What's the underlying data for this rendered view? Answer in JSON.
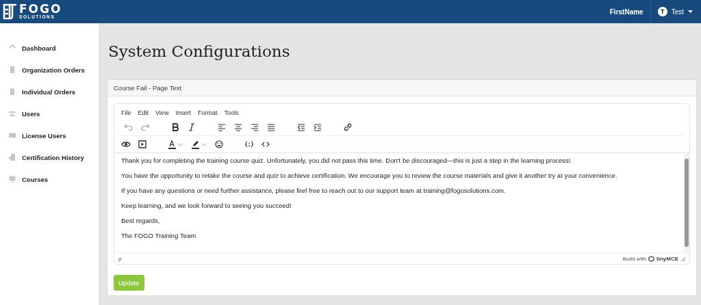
{
  "header": {
    "logo_main": "FOGO",
    "logo_sub": "SOLUTIONS",
    "user_name": "FirstName",
    "avatar_initial": "T",
    "account_label": "Test"
  },
  "sidebar": {
    "items": [
      {
        "label": "Dashboard",
        "selected": false
      },
      {
        "label": "Organization Orders",
        "selected": false
      },
      {
        "label": "Individual Orders",
        "selected": false
      },
      {
        "label": "Users",
        "selected": false
      },
      {
        "label": "License Users",
        "selected": false
      },
      {
        "label": "Certification History",
        "selected": false
      },
      {
        "label": "Courses",
        "selected": false
      }
    ]
  },
  "page_title": "System Configurations",
  "card": {
    "title": "Course Fail - Page Text",
    "editor": {
      "menu": [
        "File",
        "Edit",
        "View",
        "Insert",
        "Format",
        "Tools"
      ],
      "paragraphs": [
        "Thank you for completing the training course quiz. Unfortunately, you did not pass this time. Don't be discouraged—this is just a step in the learning process!",
        "You have the opportunity to retake the course and quiz to achieve certification. We encourage you to review the course materials and give it another try at your convenience.",
        "If you have any questions or need further assistance, please feel free to reach out to our support team at training@fogosolutions.com.",
        "Keep learning, and we look forward to seeing you succeed!",
        "Best regards,",
        "The FOGO Training Team"
      ],
      "status_path": "p",
      "branding_prefix": "Build with",
      "branding_name": "tinyMCE"
    },
    "button": "Update"
  }
}
